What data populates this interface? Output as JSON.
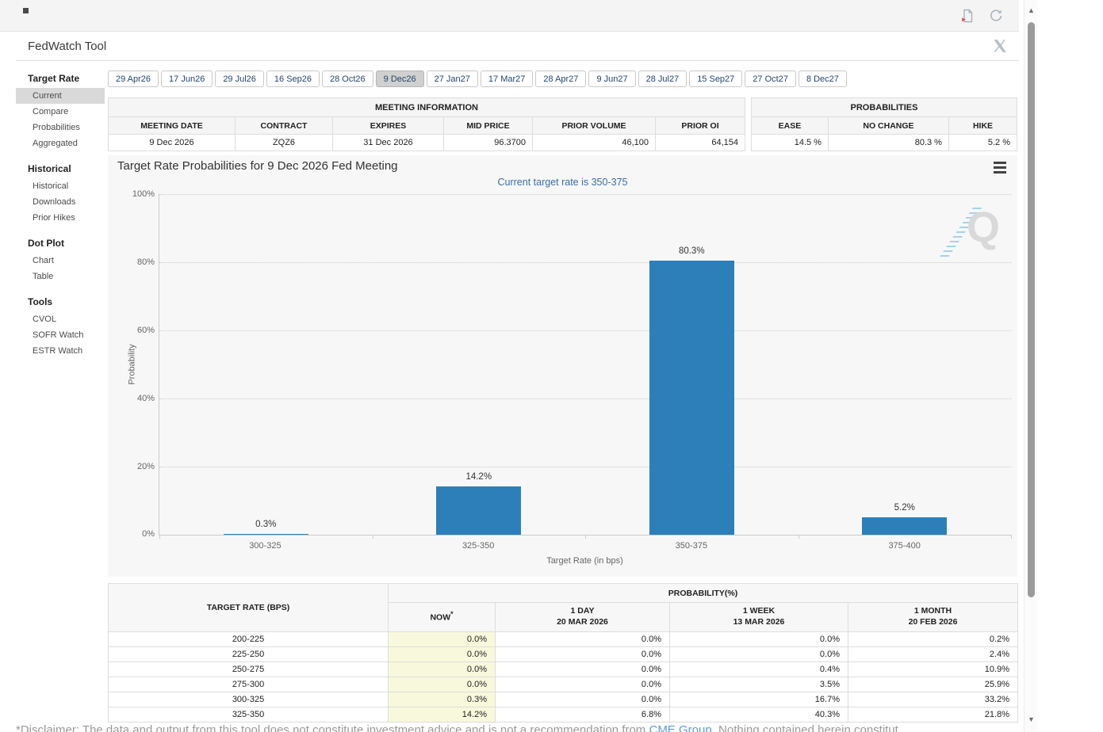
{
  "header": {
    "title": "FedWatch Tool"
  },
  "toolbar": {
    "icons": [
      "export-document-icon",
      "refresh-icon",
      "x-social-icon"
    ]
  },
  "sidebar": {
    "selected_item": "Current",
    "groups": [
      {
        "title": "Target Rate",
        "items": [
          "Current",
          "Compare",
          "Probabilities",
          "Aggregated"
        ]
      },
      {
        "title": "Historical",
        "items": [
          "Historical",
          "Downloads",
          "Prior Hikes"
        ]
      },
      {
        "title": "Dot Plot",
        "items": [
          "Chart",
          "Table"
        ]
      },
      {
        "title": "Tools",
        "items": [
          "CVOL",
          "SOFR Watch",
          "ESTR Watch"
        ]
      }
    ]
  },
  "date_tabs": {
    "selected": "9 Dec26",
    "tabs": [
      "29 Apr26",
      "17 Jun26",
      "29 Jul26",
      "16 Sep26",
      "28 Oct26",
      "9 Dec26",
      "27 Jan27",
      "17 Mar27",
      "28 Apr27",
      "9 Jun27",
      "28 Jul27",
      "15 Sep27",
      "27 Oct27",
      "8 Dec27"
    ]
  },
  "meeting_information": {
    "title": "MEETING INFORMATION",
    "columns": [
      "MEETING DATE",
      "CONTRACT",
      "EXPIRES",
      "MID PRICE",
      "PRIOR VOLUME",
      "PRIOR OI"
    ],
    "values": [
      "9 Dec 2026",
      "ZQZ6",
      "31 Dec 2026",
      "96.3700",
      "46,100",
      "64,154"
    ]
  },
  "probabilities": {
    "title": "PROBABILITIES",
    "columns": [
      "EASE",
      "NO CHANGE",
      "HIKE"
    ],
    "values": [
      "14.5 %",
      "80.3 %",
      "5.2 %"
    ]
  },
  "chart_data": {
    "type": "bar",
    "title": "Target Rate Probabilities for 9 Dec 2026 Fed Meeting",
    "subtitle": "Current target rate is 350-375",
    "categories": [
      "300-325",
      "325-350",
      "350-375",
      "375-400"
    ],
    "values": [
      0.3,
      14.2,
      80.3,
      5.2
    ],
    "bar_labels": [
      "0.3%",
      "14.2%",
      "80.3%",
      "5.2%"
    ],
    "xlabel": "Target Rate (in bps)",
    "ylabel": "Probability",
    "ylim": [
      0,
      100
    ],
    "yticks": [
      "100%",
      "80%",
      "60%",
      "40%",
      "20%",
      "0%"
    ],
    "grid": "dotted-horizontal",
    "legend": "none",
    "bar_color": "#2c7fb8",
    "watermark": "Q"
  },
  "probability_table": {
    "corner_header": "TARGET RATE (BPS)",
    "group_header": "PROBABILITY(%)",
    "col_headers": [
      {
        "l1": "NOW",
        "sup": "*",
        "l2": ""
      },
      {
        "l1": "1 DAY",
        "l2": "20 MAR 2026"
      },
      {
        "l1": "1 WEEK",
        "l2": "13 MAR 2026"
      },
      {
        "l1": "1 MONTH",
        "l2": "20 FEB 2026"
      }
    ],
    "rows": [
      {
        "rate": "200-225",
        "values": [
          "0.0%",
          "0.0%",
          "0.0%",
          "0.2%"
        ]
      },
      {
        "rate": "225-250",
        "values": [
          "0.0%",
          "0.0%",
          "0.0%",
          "2.4%"
        ]
      },
      {
        "rate": "250-275",
        "values": [
          "0.0%",
          "0.0%",
          "0.4%",
          "10.9%"
        ]
      },
      {
        "rate": "275-300",
        "values": [
          "0.0%",
          "0.0%",
          "3.5%",
          "25.9%"
        ]
      },
      {
        "rate": "300-325",
        "values": [
          "0.3%",
          "0.0%",
          "16.7%",
          "33.2%"
        ]
      },
      {
        "rate": "325-350",
        "values": [
          "14.2%",
          "6.8%",
          "40.3%",
          "21.8%"
        ]
      }
    ]
  },
  "disclaimer": {
    "pre": "*Disclaimer: The data and output from this tool does not constitute investment advice and is not a recommendation from ",
    "link": "CME Group",
    "post": ". Nothing contained herein constitut"
  }
}
